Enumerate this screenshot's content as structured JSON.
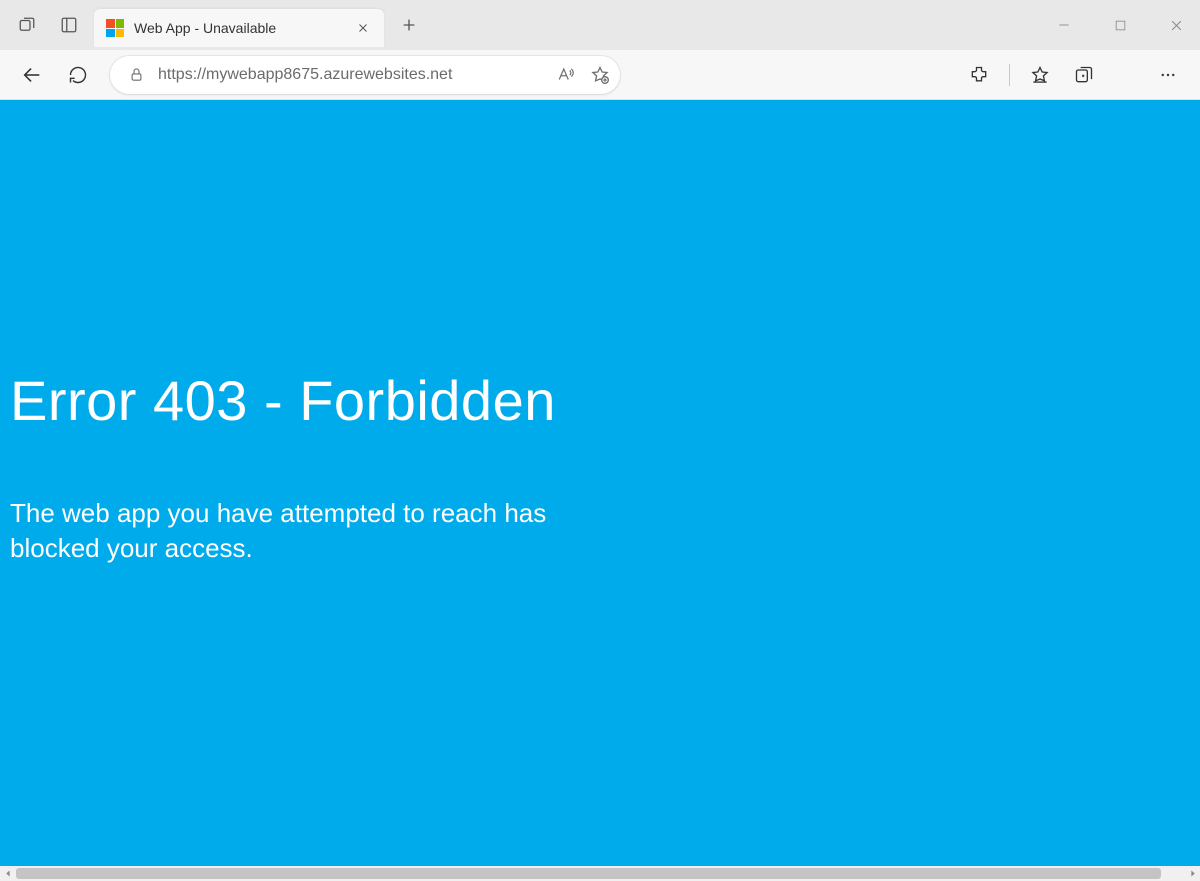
{
  "tab": {
    "title": "Web App - Unavailable"
  },
  "address_bar": {
    "url": "https://mywebapp8675.azurewebsites.net"
  },
  "page": {
    "heading": "Error 403 - Forbidden",
    "message": "The web app you have attempted to reach has blocked your access."
  },
  "colors": {
    "page_bg": "#00abec",
    "page_fg": "#ffffff"
  }
}
